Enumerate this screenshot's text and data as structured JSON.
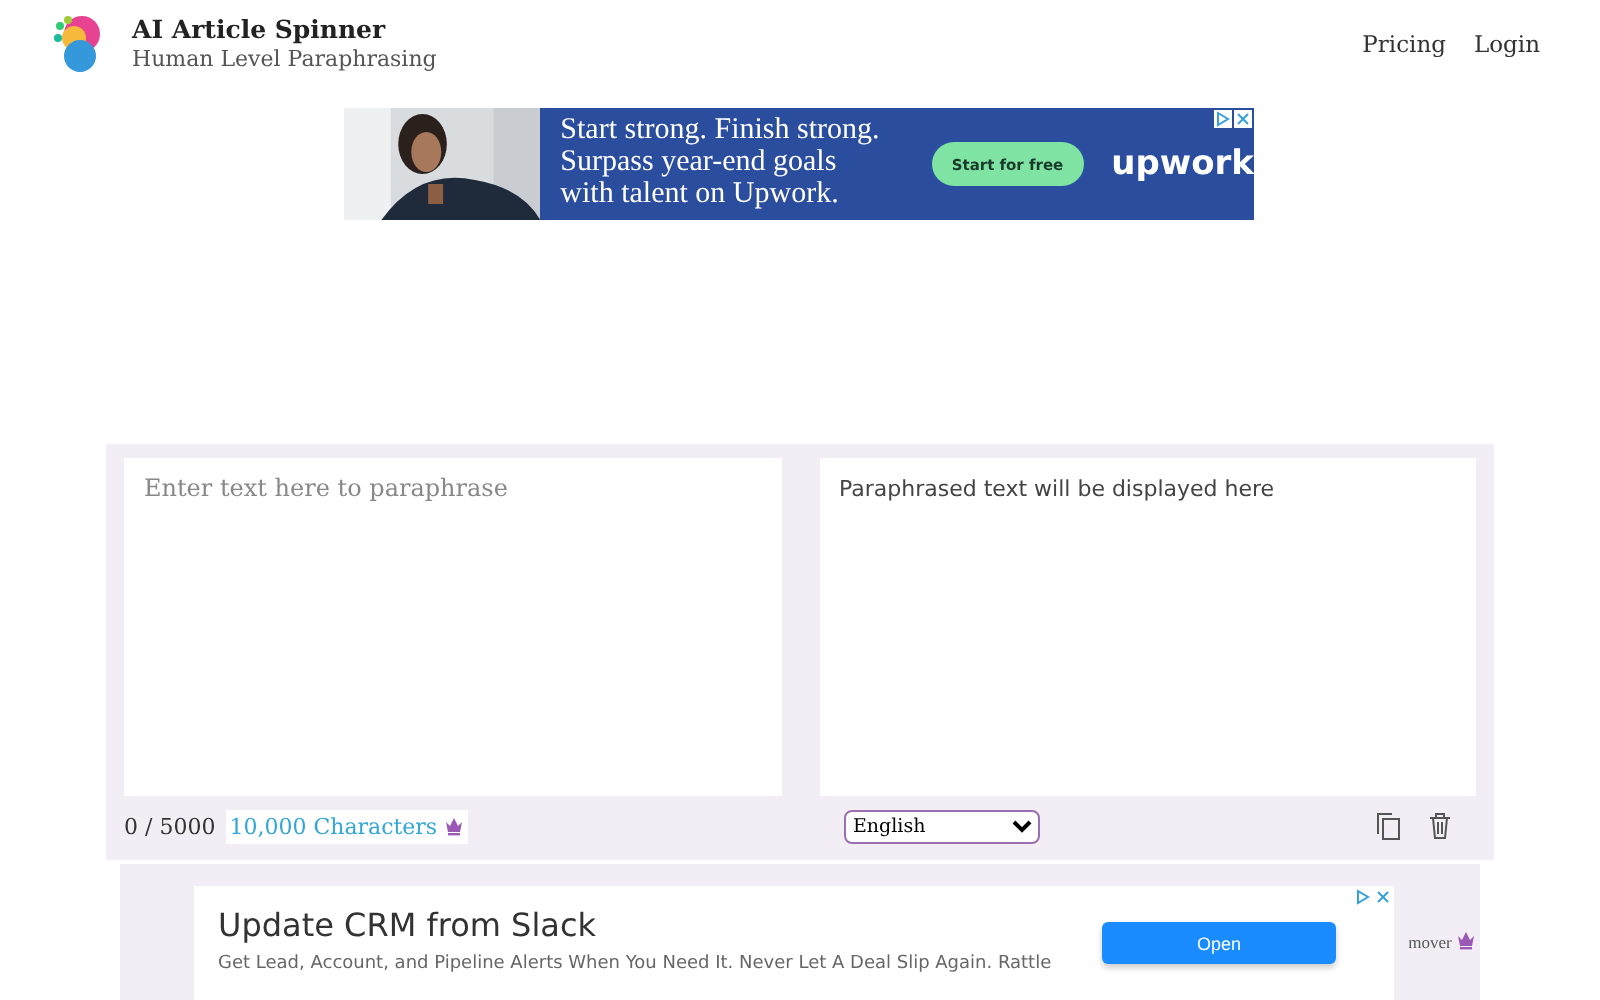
{
  "header": {
    "title": "AI Article Spinner",
    "subtitle": "Human Level Paraphrasing",
    "nav": [
      {
        "label": "Pricing"
      },
      {
        "label": "Login"
      }
    ]
  },
  "top_ad": {
    "headline": [
      "Start strong. Finish strong.",
      "Surpass year-end goals",
      "with talent on Upwork."
    ],
    "button": "Start for free",
    "brand": "upwork"
  },
  "editor": {
    "input": {
      "placeholder": "Enter text here to paraphrase"
    },
    "output": {
      "text": "Paraphrased text will be displayed here"
    },
    "counter": "0 / 5000",
    "upgrade_link": "10,000 Characters",
    "language": "English"
  },
  "bottom_panel": {
    "right_text": "mover"
  },
  "bottom_ad": {
    "title": "Update CRM from Slack",
    "text": "Get Lead, Account, and Pipeline Alerts When You Need It. Never Let A Deal Slip Again. Rattle",
    "button": "Open"
  }
}
